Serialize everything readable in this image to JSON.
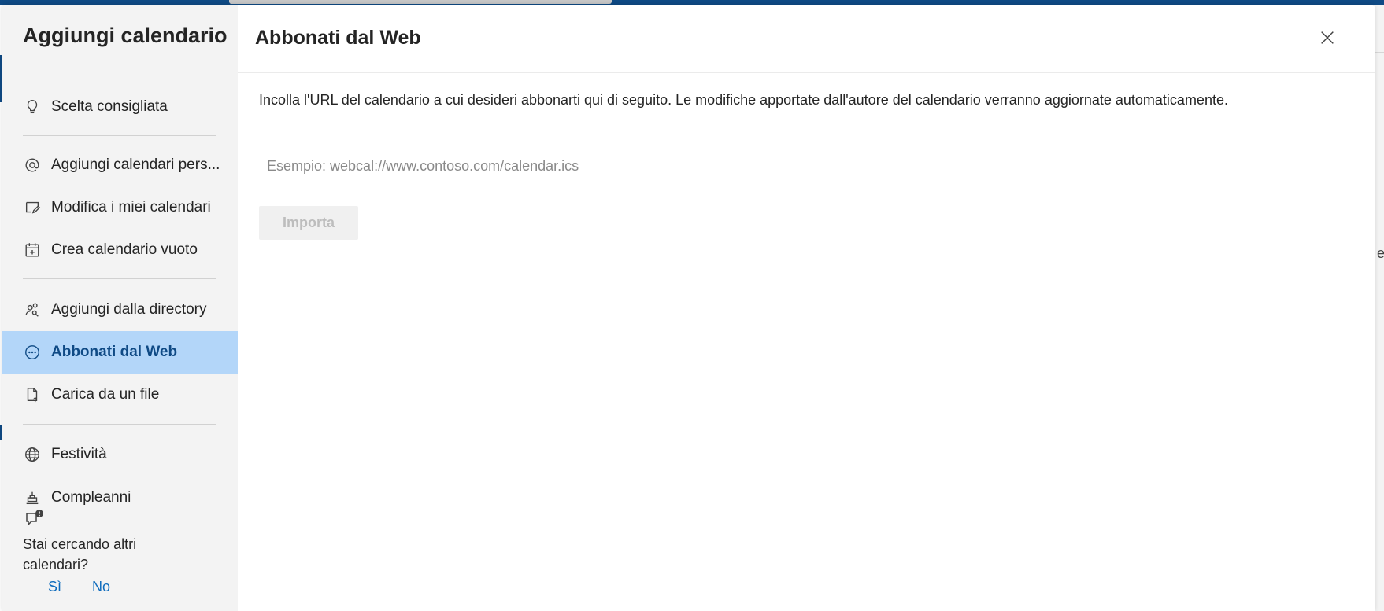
{
  "sidebar": {
    "title": "Aggiungi calendario",
    "items": [
      {
        "label": "Scelta consigliata",
        "icon": "lightbulb-icon"
      },
      {
        "label": "Aggiungi calendari pers...",
        "icon": "at-sign-icon"
      },
      {
        "label": "Modifica i miei calendari",
        "icon": "edit-note-icon"
      },
      {
        "label": "Crea calendario vuoto",
        "icon": "calendar-add-icon"
      },
      {
        "label": "Aggiungi dalla directory",
        "icon": "people-search-icon"
      },
      {
        "label": "Abbonati dal Web",
        "icon": "web-link-icon",
        "selected": true
      },
      {
        "label": "Carica da un file",
        "icon": "file-upload-icon"
      },
      {
        "label": "Festività",
        "icon": "globe-icon"
      },
      {
        "label": "Compleanni",
        "icon": "cake-icon"
      }
    ],
    "feedback": {
      "question": "Stai cercando altri calendari?",
      "yes": "Sì",
      "no": "No",
      "icon": "feedback-alert-icon"
    }
  },
  "main": {
    "title": "Abbonati dal Web",
    "description": "Incolla l'URL del calendario a cui desideri abbonarti qui di seguito. Le modifiche apportate dall'autore del calendario verranno aggiornate automaticamente.",
    "url_input": {
      "placeholder": "Esempio: webcal://www.contoso.com/calendar.ics",
      "value": ""
    },
    "import_label": "Importa",
    "close_icon": "close-icon"
  },
  "background": {
    "peek_text": "es"
  },
  "colors": {
    "accent": "#0f4a85",
    "selected_bg": "#b3d6f9",
    "sidebar_bg": "#f3f3f3",
    "link": "#0f6cbd",
    "disabled_text": "#bdbdbd"
  }
}
